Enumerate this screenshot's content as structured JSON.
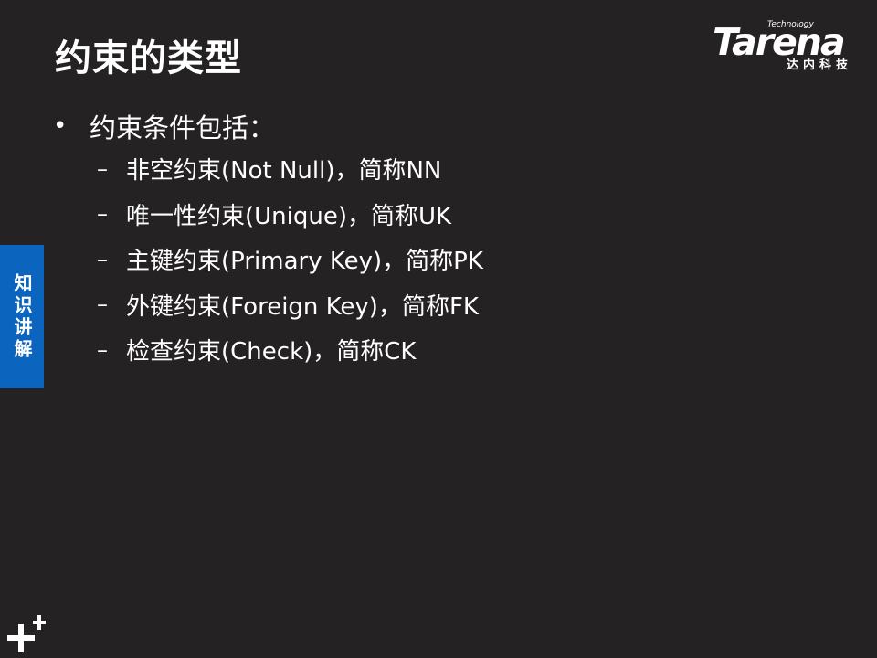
{
  "slide": {
    "title": "约束的类型",
    "logo": {
      "technology": "Technology",
      "wordmark": "Tarena",
      "chinese": "达内科技"
    },
    "side_tab": "知识讲解",
    "bullet": {
      "text": "约束条件包括：",
      "items": [
        "非空约束(Not Null)，简称NN",
        "唯一性约束(Unique)，简称UK",
        "主键约束(Primary Key)，简称PK",
        "外键约束(Foreign Key)，简称FK",
        "检查约束(Check)，简称CK"
      ]
    }
  }
}
